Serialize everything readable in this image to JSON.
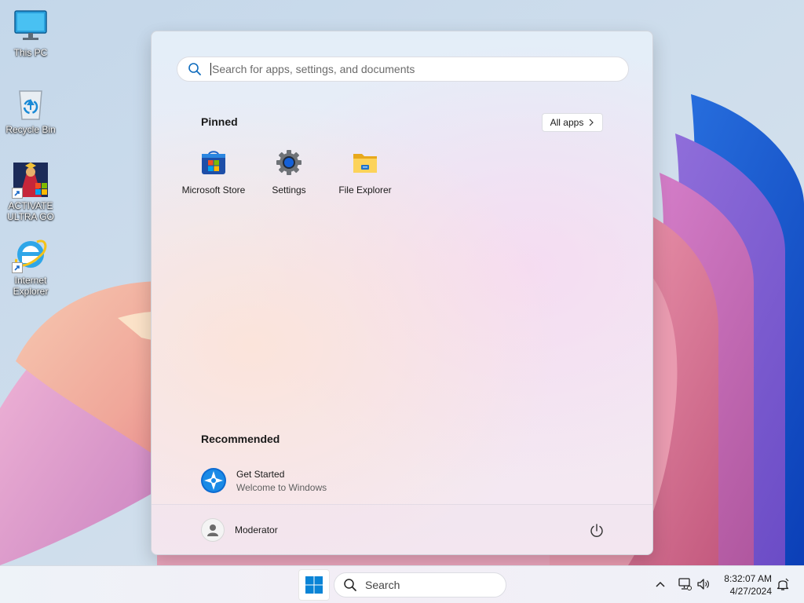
{
  "desktop": {
    "icons": [
      {
        "label": "This PC"
      },
      {
        "label": "Recycle Bin"
      },
      {
        "label": "ACTIVATE ULTRA GO"
      },
      {
        "label": "Internet Explorer"
      }
    ]
  },
  "start_menu": {
    "search": {
      "placeholder": "Search for apps, settings, and documents",
      "value": ""
    },
    "pinned": {
      "title": "Pinned",
      "all_apps_label": "All apps",
      "apps": [
        {
          "label": "Microsoft Store",
          "icon": "microsoft-store-icon"
        },
        {
          "label": "Settings",
          "icon": "settings-gear-icon"
        },
        {
          "label": "File Explorer",
          "icon": "file-explorer-folder-icon"
        }
      ]
    },
    "recommended": {
      "title": "Recommended",
      "items": [
        {
          "title": "Get Started",
          "subtitle": "Welcome to Windows",
          "icon": "get-started-icon"
        }
      ]
    },
    "user": {
      "name": "Moderator"
    },
    "power_icon": "power-icon"
  },
  "taskbar": {
    "search_label": "Search",
    "clock": {
      "time": "8:32:07 AM",
      "date": "4/27/2024"
    },
    "tray_icons": [
      "chevron-up-icon",
      "network-icon",
      "volume-icon",
      "notification-icon"
    ]
  },
  "colors": {
    "accent": "#0067c0",
    "windows_blue": "#0a84d6",
    "folder_yellow": "#f5c342"
  }
}
